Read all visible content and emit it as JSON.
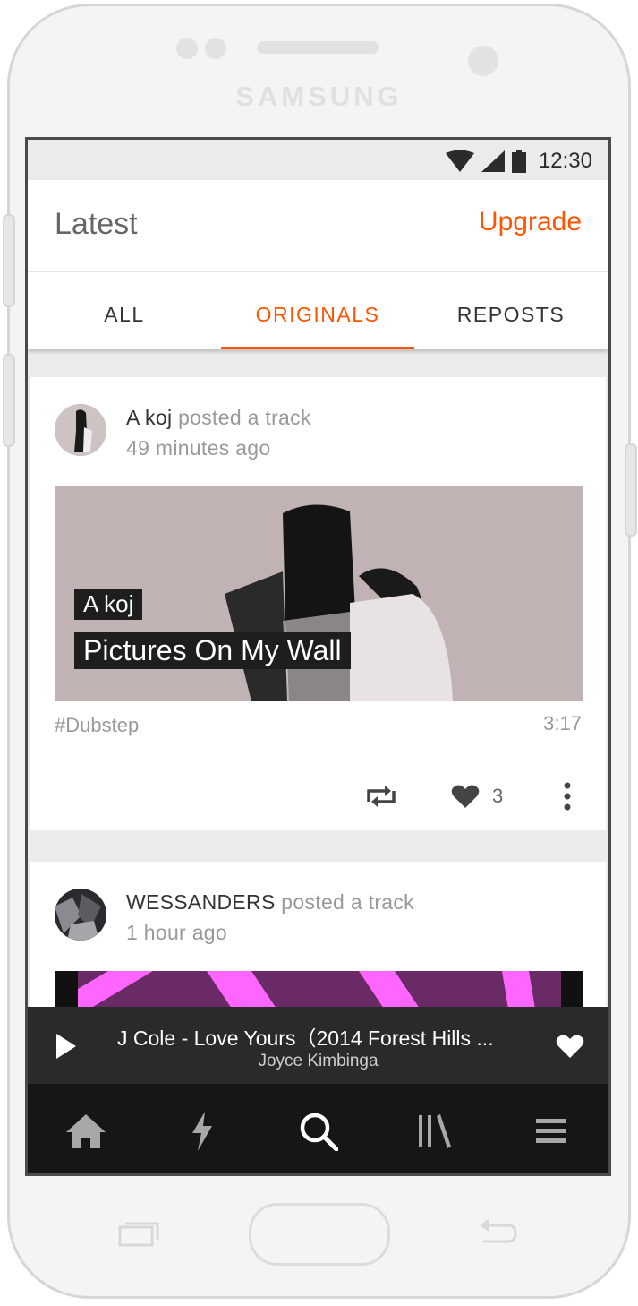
{
  "device": {
    "brand": "SAMSUNG"
  },
  "status_bar": {
    "time": "12:30",
    "icons": [
      "wifi-icon",
      "signal-icon",
      "battery-icon"
    ]
  },
  "header": {
    "title": "Latest",
    "upgrade_label": "Upgrade"
  },
  "tabs": [
    {
      "label": "ALL",
      "active": false
    },
    {
      "label": "ORIGINALS",
      "active": true
    },
    {
      "label": "REPOSTS",
      "active": false
    }
  ],
  "feed": [
    {
      "user": "A koj",
      "action": "posted a track",
      "time_ago": "49 minutes ago",
      "artwork_artist": "A koj",
      "artwork_title": "Pictures On My Wall",
      "tag": "#Dubstep",
      "duration": "3:17",
      "likes": "3"
    },
    {
      "user": "WESSANDERS",
      "action": "posted a track",
      "time_ago": "1 hour ago"
    }
  ],
  "mini_player": {
    "title": "J Cole - Love Yours（2014 Forest Hills ...",
    "artist": "Joyce Kimbinga"
  },
  "bottom_nav": [
    "home-icon",
    "stream-icon",
    "search-icon",
    "library-icon",
    "menu-icon"
  ],
  "colors": {
    "accent": "#ff5500",
    "nav_bg": "#161616",
    "player_bg": "#2a2a2a"
  }
}
